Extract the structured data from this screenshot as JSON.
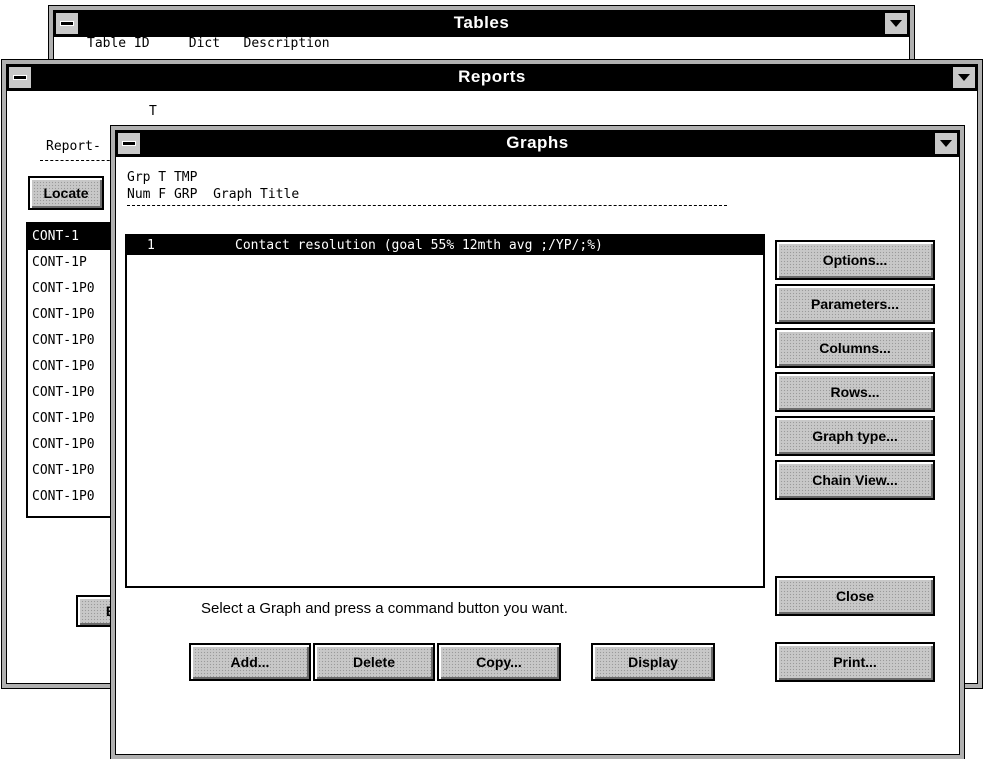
{
  "tables_window": {
    "title": "Tables",
    "header_partial": "Table ID     Dict   Description"
  },
  "reports_window": {
    "title": "Reports",
    "cursor": "T",
    "report_label": "Report-",
    "locate_button": "Locate",
    "report_list": [
      "CONT-1",
      "CONT-1P",
      "CONT-1P0",
      "CONT-1P0",
      "CONT-1P0",
      "CONT-1P0",
      "CONT-1P0",
      "CONT-1P0",
      "CONT-1P0",
      "CONT-1P0",
      "CONT-1P0"
    ],
    "bottom_button": "B"
  },
  "graphs_window": {
    "title": "Graphs",
    "header_line1": "Grp T TMP",
    "header_line2": "Num F GRP  Graph Title",
    "rows": [
      {
        "num": "1",
        "title": "Contact resolution (goal 55% 12mth avg ;/YP/;%)"
      }
    ],
    "side_buttons": [
      "Options...",
      "Parameters...",
      "Columns...",
      "Rows...",
      "Graph type...",
      "Chain View..."
    ],
    "close_button": "Close",
    "print_button": "Print...",
    "instruction": "Select a Graph and press a command button you want.",
    "bottom_buttons": [
      "Add...",
      "Delete",
      "Copy...",
      "Display"
    ]
  }
}
